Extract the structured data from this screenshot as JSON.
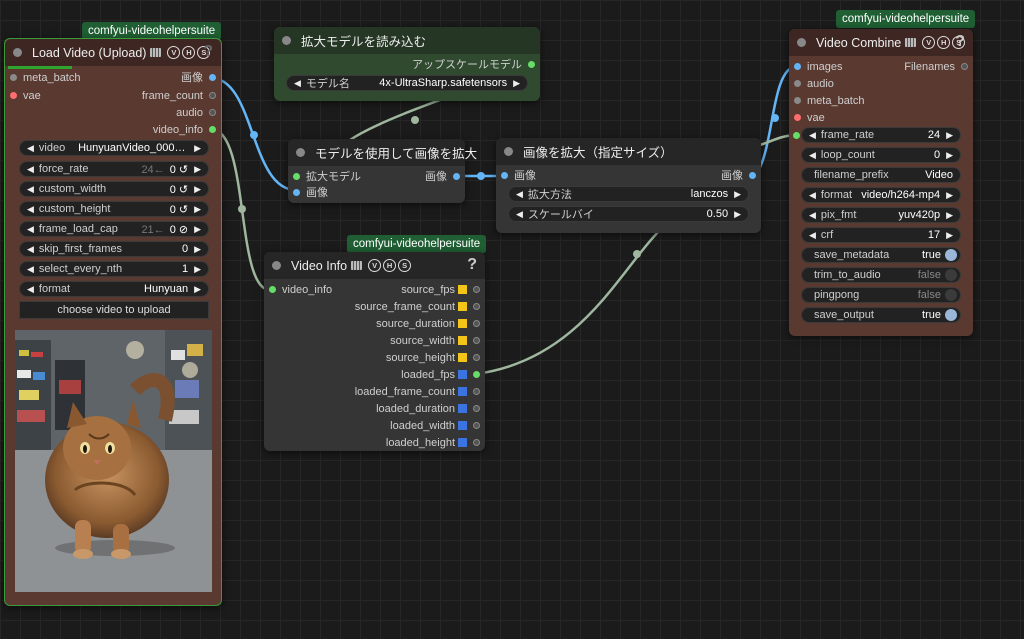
{
  "load_video": {
    "group_tag": "comfyui-videohelpersuite",
    "title": "Load Video (Upload)",
    "badges": [
      "V",
      "H",
      "S"
    ],
    "help": "?",
    "inputs": [
      "meta_batch",
      "vae"
    ],
    "outputs": [
      "画像",
      "frame_count",
      "audio",
      "video_info"
    ],
    "widgets": {
      "video": {
        "label": "video",
        "value": "HunyuanVideo_00002..."
      },
      "force_rate": {
        "label": "force_rate",
        "hint": "24←",
        "value": "0 ↺"
      },
      "custom_width": {
        "label": "custom_width",
        "value": "0 ↺"
      },
      "custom_height": {
        "label": "custom_height",
        "value": "0 ↺"
      },
      "frame_load_cap": {
        "label": "frame_load_cap",
        "hint": "21←",
        "value": "0 ⊘"
      },
      "skip_first_frames": {
        "label": "skip_first_frames",
        "value": "0"
      },
      "select_every_nth": {
        "label": "select_every_nth",
        "value": "1"
      },
      "format": {
        "label": "format",
        "value": "Hunyuan"
      }
    },
    "upload_button": "choose video to upload"
  },
  "load_upscale_model": {
    "title": "拡大モデルを読み込む",
    "output": "アップスケールモデル",
    "widget": {
      "label": "モデル名",
      "value": "4x-UltraSharp.safetensors"
    }
  },
  "upscale_with_model": {
    "title": "モデルを使用して画像を拡大",
    "inputs": [
      "拡大モデル",
      "画像"
    ],
    "output": "画像"
  },
  "image_scale": {
    "title": "画像を拡大（指定サイズ）",
    "input": "画像",
    "output": "画像",
    "widgets": {
      "method": {
        "label": "拡大方法",
        "value": "lanczos"
      },
      "scale": {
        "label": "スケールバイ",
        "value": "0.50"
      }
    }
  },
  "video_info": {
    "group_tag": "comfyui-videohelpersuite",
    "title": "Video Info",
    "help": "?",
    "input": "video_info",
    "outputs": [
      "source_fps",
      "source_frame_count",
      "source_duration",
      "source_width",
      "source_height",
      "loaded_fps",
      "loaded_frame_count",
      "loaded_duration",
      "loaded_width",
      "loaded_height"
    ]
  },
  "video_combine": {
    "group_tag": "comfyui-videohelpersuite",
    "title": "Video Combine",
    "help": "?",
    "inputs": [
      "images",
      "audio",
      "meta_batch",
      "vae"
    ],
    "output": "Filenames",
    "widgets": {
      "frame_rate": {
        "label": "frame_rate",
        "value": "24"
      },
      "loop_count": {
        "label": "loop_count",
        "value": "0"
      },
      "filename_prefix": {
        "label": "filename_prefix",
        "value": "Video"
      },
      "format": {
        "label": "format",
        "value": "video/h264-mp4"
      },
      "pix_fmt": {
        "label": "pix_fmt",
        "value": "yuv420p"
      },
      "crf": {
        "label": "crf",
        "value": "17"
      },
      "save_metadata": {
        "label": "save_metadata",
        "value": "true"
      },
      "trim_to_audio": {
        "label": "trim_to_audio",
        "value": "false"
      },
      "pingpong": {
        "label": "pingpong",
        "value": "false"
      },
      "save_output": {
        "label": "save_output",
        "value": "true"
      }
    }
  },
  "colors": {
    "canvas": "#1b1b1b",
    "node_brown": "#593930",
    "node_gray": "#353535",
    "node_green": "#2f4a2f",
    "tag_green": "#1f5f33",
    "link_image": "#64b5f6",
    "link_info": "#9fb79f",
    "slot_int": "#66dd66",
    "slot_vae": "#ff6e6e"
  }
}
